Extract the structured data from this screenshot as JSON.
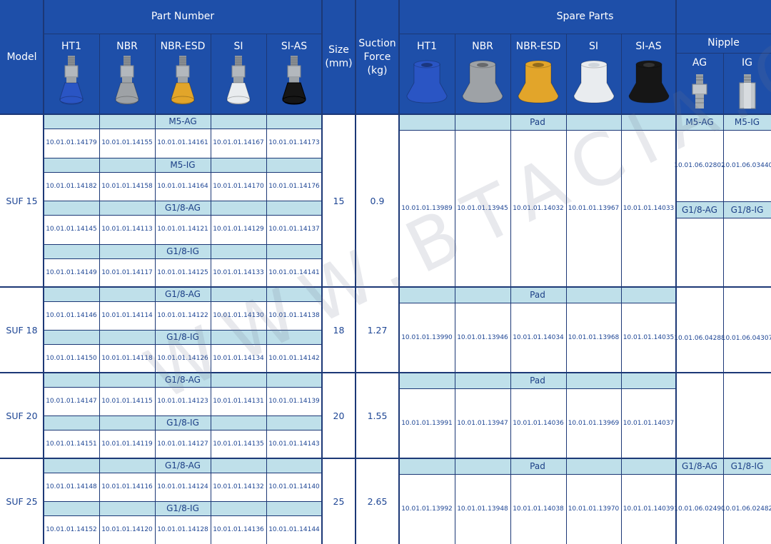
{
  "headers": {
    "model": "Model",
    "part_number": "Part Number",
    "size": "Size\n(mm)",
    "suction_force": "Suction\nForce\n(kg)",
    "spare_parts": "Spare Parts",
    "nipple": "Nipple",
    "materials": [
      "HT1",
      "NBR",
      "NBR-ESD",
      "SI",
      "SI-AS"
    ],
    "nipple_types": [
      "AG",
      "IG"
    ]
  },
  "colors": {
    "header_bg": "#1e4fa9",
    "subheader_bg": "#bfe0ea",
    "text": "#1d4594",
    "grid": "#1c3876",
    "pad_ht1": "#2a55c4",
    "pad_nbr": "#9ea2a6",
    "pad_nbr_esd": "#e2a52a",
    "pad_si": "#e9ecef",
    "pad_si_as": "#161616"
  },
  "icons": {
    "part_images": [
      "suction-cup-blue-icon",
      "suction-cup-grey-icon",
      "suction-cup-orange-icon",
      "suction-cup-clear-icon",
      "suction-cup-black-icon"
    ],
    "pad_images": [
      "pad-blue-icon",
      "pad-grey-icon",
      "pad-orange-icon",
      "pad-clear-icon",
      "pad-black-icon"
    ],
    "nipple_images": [
      "nipple-ag-icon",
      "nipple-ig-icon"
    ]
  },
  "rows": [
    {
      "model": "SUF 15",
      "size": "15",
      "force": "0.9",
      "groups": [
        {
          "thread": "M5-AG",
          "codes": [
            "10.01.01.14179",
            "10.01.01.14155",
            "10.01.01.14161",
            "10.01.01.14167",
            "10.01.01.14173"
          ]
        },
        {
          "thread": "M5-IG",
          "codes": [
            "10.01.01.14182",
            "10.01.01.14158",
            "10.01.01.14164",
            "10.01.01.14170",
            "10.01.01.14176"
          ]
        },
        {
          "thread": "G1/8-AG",
          "codes": [
            "10.01.01.14145",
            "10.01.01.14113",
            "10.01.01.14121",
            "10.01.01.14129",
            "10.01.01.14137"
          ]
        },
        {
          "thread": "G1/8-IG",
          "codes": [
            "10.01.01.14149",
            "10.01.01.14117",
            "10.01.01.14125",
            "10.01.01.14133",
            "10.01.01.14141"
          ]
        }
      ],
      "pad_label": "Pad",
      "pads": [
        "10.01.01.13989",
        "10.01.01.13945",
        "10.01.01.14032",
        "10.01.01.13967",
        "10.01.01.14033"
      ]
    },
    {
      "model": "SUF 18",
      "size": "18",
      "force": "1.27",
      "groups": [
        {
          "thread": "G1/8-AG",
          "codes": [
            "10.01.01.14146",
            "10.01.01.14114",
            "10.01.01.14122",
            "10.01.01.14130",
            "10.01.01.14138"
          ]
        },
        {
          "thread": "G1/8-IG",
          "codes": [
            "10.01.01.14150",
            "10.01.01.14118",
            "10.01.01.14126",
            "10.01.01.14134",
            "10.01.01.14142"
          ]
        }
      ],
      "pad_label": "Pad",
      "pads": [
        "10.01.01.13990",
        "10.01.01.13946",
        "10.01.01.14034",
        "10.01.01.13968",
        "10.01.01.14035"
      ]
    },
    {
      "model": "SUF 20",
      "size": "20",
      "force": "1.55",
      "groups": [
        {
          "thread": "G1/8-AG",
          "codes": [
            "10.01.01.14147",
            "10.01.01.14115",
            "10.01.01.14123",
            "10.01.01.14131",
            "10.01.01.14139"
          ]
        },
        {
          "thread": "G1/8-IG",
          "codes": [
            "10.01.01.14151",
            "10.01.01.14119",
            "10.01.01.14127",
            "10.01.01.14135",
            "10.01.01.14143"
          ]
        }
      ],
      "pad_label": "Pad",
      "pads": [
        "10.01.01.13991",
        "10.01.01.13947",
        "10.01.01.14036",
        "10.01.01.13969",
        "10.01.01.14037"
      ]
    },
    {
      "model": "SUF 25",
      "size": "25",
      "force": "2.65",
      "groups": [
        {
          "thread": "G1/8-AG",
          "codes": [
            "10.01.01.14148",
            "10.01.01.14116",
            "10.01.01.14124",
            "10.01.01.14132",
            "10.01.01.14140"
          ]
        },
        {
          "thread": "G1/8-IG",
          "codes": [
            "10.01.01.14152",
            "10.01.01.14120",
            "10.01.01.14128",
            "10.01.01.14136",
            "10.01.01.14144"
          ]
        }
      ],
      "pad_label": "Pad",
      "pads": [
        "10.01.01.13992",
        "10.01.01.13948",
        "10.01.01.14038",
        "10.01.01.13970",
        "10.01.01.14039"
      ]
    }
  ],
  "nipples": [
    {
      "ag_label": "M5-AG",
      "ig_label": "M5-IG",
      "ag_code": "10.01.06.02802",
      "ig_code": "10.01.06.03440"
    },
    {
      "ag_label": "G1/8-AG",
      "ig_label": "G1/8-IG",
      "ag_code": "10.01.06.04288",
      "ig_code": "10.01.06.04307"
    },
    {
      "ag_label": "G1/8-AG",
      "ig_label": "G1/8-IG",
      "ag_code": "10.01.06.02490",
      "ig_code": "10.01.06.02482"
    }
  ],
  "watermark": "WWW.BTACIA.CO.TH"
}
